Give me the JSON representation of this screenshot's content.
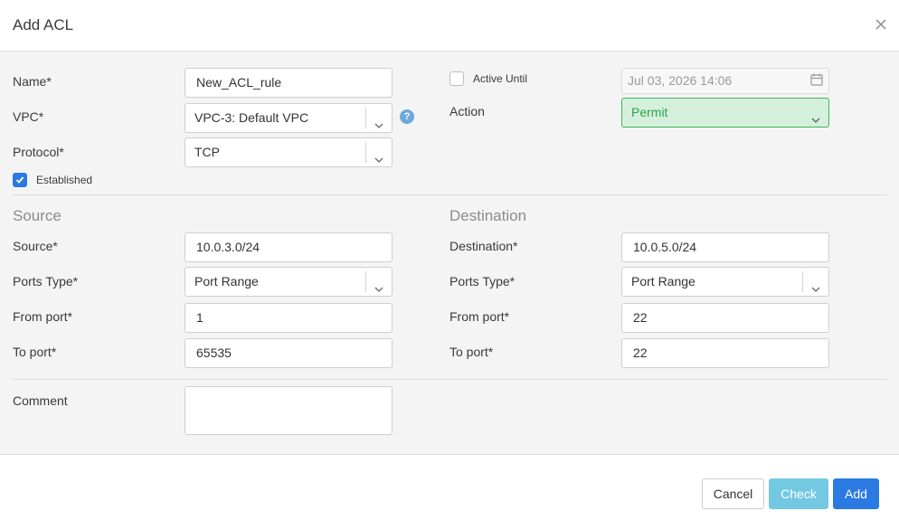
{
  "dialog": {
    "title": "Add ACL"
  },
  "form": {
    "name_label": "Name*",
    "name_value": "New_ACL_rule",
    "vpc_label": "VPC*",
    "vpc_value": "VPC-3: Default VPC",
    "vpc_help": "?",
    "protocol_label": "Protocol*",
    "protocol_value": "TCP",
    "established_label": "Established",
    "established_checked": true,
    "active_until_label": "Active Until",
    "active_until_checked": false,
    "active_until_value": "Jul 03, 2026 14:06",
    "action_label": "Action",
    "action_value": "Permit",
    "comment_label": "Comment",
    "comment_value": ""
  },
  "source": {
    "section_title": "Source",
    "address_label": "Source*",
    "address_value": "10.0.3.0/24",
    "ports_type_label": "Ports Type*",
    "ports_type_value": "Port Range",
    "from_port_label": "From port*",
    "from_port_value": "1",
    "to_port_label": "To port*",
    "to_port_value": "65535"
  },
  "destination": {
    "section_title": "Destination",
    "address_label": "Destination*",
    "address_value": "10.0.5.0/24",
    "ports_type_label": "Ports Type*",
    "ports_type_value": "Port Range",
    "from_port_label": "From port*",
    "from_port_value": "22",
    "to_port_label": "To port*",
    "to_port_value": "22"
  },
  "footer": {
    "cancel_label": "Cancel",
    "check_label": "Check",
    "add_label": "Add"
  },
  "colors": {
    "primary": "#2a7ae2",
    "check": "#5bc0de",
    "permit_bg": "#d4f0dc",
    "permit_border": "#3fb65b"
  },
  "icons": [
    "close-icon",
    "chevron-down-icon",
    "calendar-icon",
    "help-icon",
    "checkmark-icon"
  ]
}
